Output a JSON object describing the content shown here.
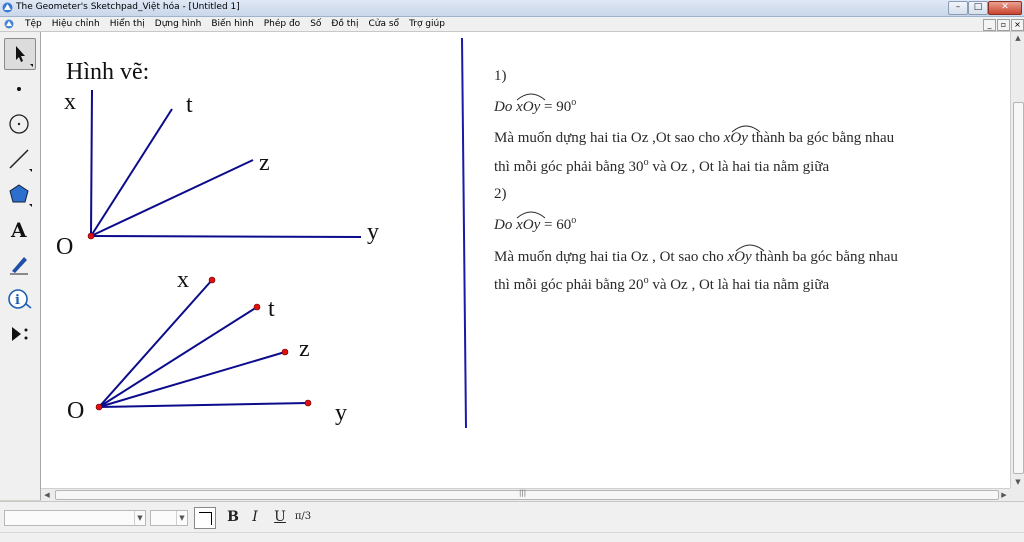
{
  "window": {
    "title": "The Geometer's Sketchpad_Việt hóa - [Untitled 1]"
  },
  "menu": [
    "Tệp",
    "Hiệu chỉnh",
    "Hiển thị",
    "Dựng hình",
    "Biến hình",
    "Phép đo",
    "Số",
    "Đồ thị",
    "Cửa sổ",
    "Trợ giúp"
  ],
  "tools": [
    "arrow-select-tool",
    "point-tool",
    "compass-tool",
    "straightedge-tool",
    "polygon-tool",
    "text-tool",
    "marker-tool",
    "information-tool",
    "custom-tool"
  ],
  "sketch": {
    "heading": "Hình vẽ:",
    "figure1": {
      "labels": {
        "x": "x",
        "t": "t",
        "z": "z",
        "y": "y",
        "o": "O"
      }
    },
    "figure2": {
      "labels": {
        "x": "x",
        "t": "t",
        "z": "z",
        "y": "y",
        "o": "O"
      }
    },
    "colors": {
      "ray": "#0b0b8c",
      "point": "#e01010",
      "divider": "#1a1aa8"
    }
  },
  "text_panel": {
    "p1_num": "1)",
    "p1_do": "Do ",
    "p1_angle": "xOy",
    "p1_eq": " = 90",
    "p1_deg": "o",
    "p1_line1_a": "Mà muốn dựng hai tia Oz ,Ot sao cho ",
    "p1_line1_angle": "xOy",
    "p1_line1_b": " thành ba góc bằng nhau",
    "p1_line2_a": "thì mỗi góc phải bằng 30",
    "p1_line2_deg": "o",
    "p1_line2_b": " và Oz , Ot là hai tia nằm giữa",
    "p2_num": "2)",
    "p2_do": "Do ",
    "p2_angle": "xOy",
    "p2_eq": " = 60",
    "p2_deg": "o",
    "p2_line1_a": "Mà muốn dựng hai tia Oz , Ot sao cho ",
    "p2_line1_angle": "xOy",
    "p2_line1_b": " thành ba góc bằng nhau",
    "p2_line2_a": "thì mỗi góc phải bằng 20",
    "p2_line2_deg": "o",
    "p2_line2_b": " và Oz , Ot là hai tia nằm giữa"
  },
  "text_toolbar": {
    "bold": "B",
    "italic": "I",
    "underline": "U",
    "math": "π/3"
  }
}
